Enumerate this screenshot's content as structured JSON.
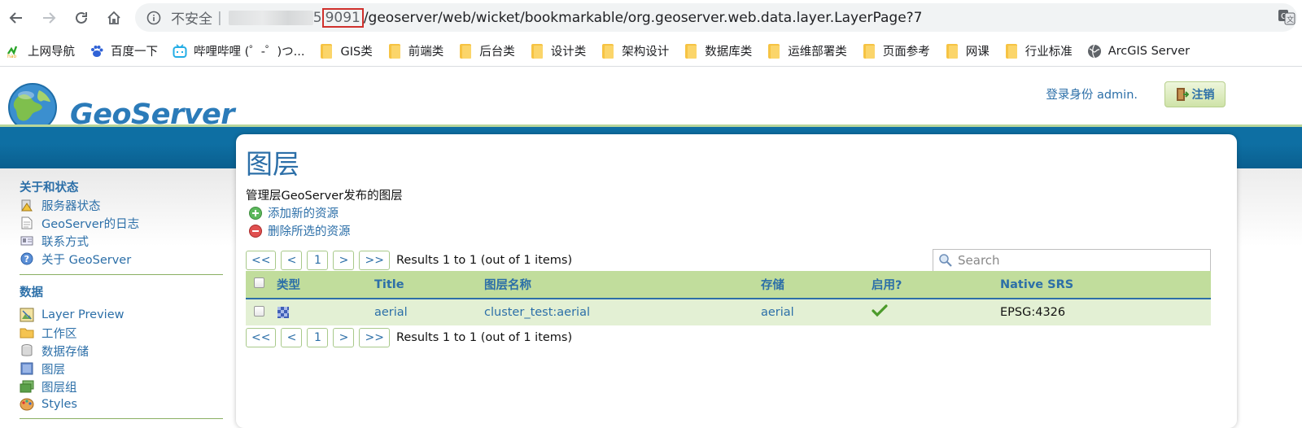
{
  "browser": {
    "security_label": "不安全",
    "separator": "|",
    "host_tail": "5",
    "port": "9091",
    "path": "/geoserver/web/wicket/bookmarkable/org.geoserver.web.data.layer.LayerPage?7",
    "bookmarks": [
      {
        "label": "上网导航",
        "icon": "hao-icon"
      },
      {
        "label": "百度一下",
        "icon": "baidu-icon"
      },
      {
        "label": "哔哩哔哩 (゜-゜)つ...",
        "icon": "bilibili-icon"
      },
      {
        "label": "GIS类",
        "icon": "folder-icon"
      },
      {
        "label": "前端类",
        "icon": "folder-icon"
      },
      {
        "label": "后台类",
        "icon": "folder-icon"
      },
      {
        "label": "设计类",
        "icon": "folder-icon"
      },
      {
        "label": "架构设计",
        "icon": "folder-icon"
      },
      {
        "label": "数据库类",
        "icon": "folder-icon"
      },
      {
        "label": "运维部署类",
        "icon": "folder-icon"
      },
      {
        "label": "页面参考",
        "icon": "folder-icon"
      },
      {
        "label": "网课",
        "icon": "folder-icon"
      },
      {
        "label": "行业标准",
        "icon": "folder-icon"
      },
      {
        "label": "ArcGIS Server",
        "icon": "globe-icon"
      }
    ]
  },
  "header": {
    "logo_text": "GeoServer",
    "login_text": "登录身份 admin.",
    "logout_label": "注销"
  },
  "sidebar": {
    "sections": [
      {
        "title": "关于和状态",
        "items": [
          {
            "label": "服务器状态",
            "icon": "server-status-icon"
          },
          {
            "label": "GeoServer的日志",
            "icon": "log-icon"
          },
          {
            "label": "联系方式",
            "icon": "contact-icon"
          },
          {
            "label": "关于 GeoServer",
            "icon": "help-icon"
          }
        ]
      },
      {
        "title": "数据",
        "items": [
          {
            "label": "Layer Preview",
            "icon": "layer-preview-icon"
          },
          {
            "label": "工作区",
            "icon": "workspace-folder-icon"
          },
          {
            "label": "数据存储",
            "icon": "datastore-icon"
          },
          {
            "label": "图层",
            "icon": "layer-icon"
          },
          {
            "label": "图层组",
            "icon": "layer-group-icon"
          },
          {
            "label": "Styles",
            "icon": "styles-icon"
          }
        ]
      }
    ]
  },
  "main": {
    "title": "图层",
    "description": "管理层GeoServer发布的图层",
    "add_label": "添加新的资源",
    "remove_label": "删除所选的资源",
    "pager": {
      "first": "<<",
      "prev": "<",
      "page": "1",
      "next": ">",
      "last": ">>",
      "results": "Results 1 to 1 (out of 1 items)"
    },
    "search_placeholder": "Search",
    "table": {
      "columns": [
        "类型",
        "Title",
        "图层名称",
        "存储",
        "启用?",
        "Native SRS"
      ],
      "rows": [
        {
          "title": "aerial",
          "name": "cluster_test:aerial",
          "store": "aerial",
          "enabled": true,
          "srs": "EPSG:4326"
        }
      ]
    }
  },
  "colors": {
    "link": "#2c6fa8",
    "band": "#0e6fa3",
    "table_header": "#c1dd9c",
    "table_row": "#e3f0d4",
    "url_highlight": "#d0312d"
  }
}
